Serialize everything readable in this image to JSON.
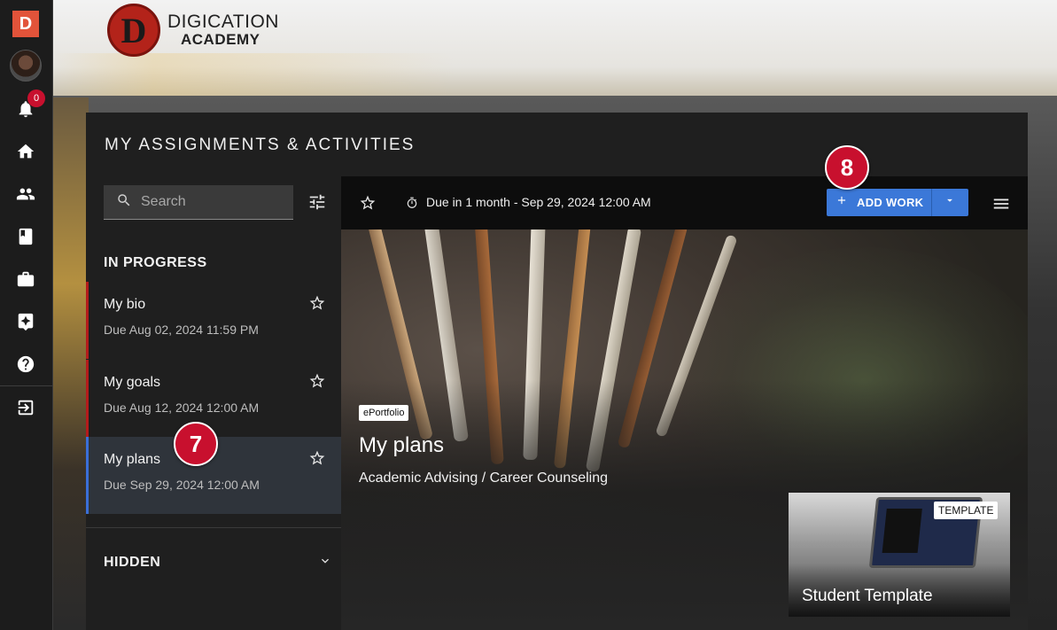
{
  "sidebar": {
    "logo_letter": "D",
    "notifications_count": "0",
    "icons": [
      "bell-icon",
      "home-icon",
      "people-icon",
      "book-icon",
      "briefcase-icon",
      "sparkle-icon",
      "help-icon",
      "logout-icon"
    ]
  },
  "brand": {
    "mark_letter": "D",
    "line1": "DIGICATION",
    "line2": "ACADEMY"
  },
  "page": {
    "title": "MY ASSIGNMENTS & ACTIVITIES"
  },
  "list": {
    "search_placeholder": "Search",
    "in_progress_label": "IN PROGRESS",
    "hidden_label": "HIDDEN",
    "items": [
      {
        "title": "My bio",
        "due": "Due Aug 02, 2024 11:59 PM"
      },
      {
        "title": "My goals",
        "due": "Due Aug 12, 2024 12:00 AM"
      },
      {
        "title": "My plans",
        "due": "Due Sep 29, 2024 12:00 AM"
      }
    ]
  },
  "detail": {
    "due_text": "Due in 1 month - Sep 29, 2024 12:00 AM",
    "add_work_label": "ADD WORK",
    "tag": "ePortfolio",
    "title": "My plans",
    "subtitle": "Academic Advising / Career Counseling",
    "template": {
      "badge": "TEMPLATE",
      "title": "Student Template"
    }
  },
  "markers": {
    "seven": "7",
    "eight": "8"
  },
  "colors": {
    "accent_blue": "#3b78d8",
    "alert_red": "#c8102e",
    "logo_orange": "#e2533a"
  }
}
